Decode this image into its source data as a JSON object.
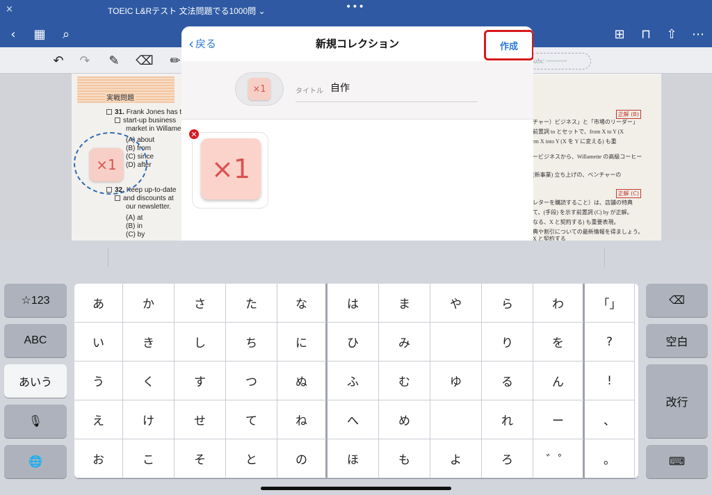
{
  "app": {
    "close_glyph": "×",
    "window_title": "TOEIC L&Rテスト 文法問題でる1000問 ⌄",
    "dots": "•••"
  },
  "nav": {
    "icons": [
      "back-icon",
      "grid-icon",
      "search-icon",
      "add-page-icon",
      "bookmark-icon",
      "share-icon",
      "more-icon"
    ],
    "glyphs": {
      "back": "‹",
      "grid": "▦",
      "search": "⌕",
      "addpage": "⊞",
      "bookmark": "⊓",
      "share": "⇧",
      "more": "⋯"
    }
  },
  "toolbar": {
    "tools": [
      "undo-icon",
      "redo-icon",
      "pen-icon",
      "eraser-icon",
      "highlighter-icon"
    ],
    "glyphs": {
      "undo": "↶",
      "redo": "↷",
      "pen": "✎",
      "eraser": "⌫",
      "highlighter": "✏"
    },
    "abc_placeholder": "abc ~~~~~"
  },
  "document": {
    "section_header": "実戦問題",
    "q31": {
      "number": "31.",
      "lines": [
        "Frank Jones has t",
        "start-up business",
        "market in Willame"
      ],
      "options": [
        "(A) about",
        "(B) from",
        "(C) since",
        "(D) after"
      ]
    },
    "q32": {
      "number": "32.",
      "lines": [
        "Keep up-to-date",
        "and discounts at",
        "our newsletter."
      ],
      "options": [
        "(A) at",
        "(B) in",
        "(C) by"
      ]
    },
    "right_lines": [
      "チャー）ビジネス」と「市場のリーダー」",
      "前置詞 to とセットで、from X to Y (X",
      "rm X into Y (X を Y に変える) も重",
      "",
      "ービジネスから、Willamette の高級コーヒー",
      "",
      "(新事業) 立ち上げの、ベンチャーの",
      "",
      "レターを購読すること）は、店舗の特典",
      "て、(手段) を示す前置詞 (C) by が正解。",
      "なる、X と契約する) も重要表現。",
      "典や割引についての最新情報を得ましょう。",
      "X と契約する"
    ],
    "answer_tags": [
      "正解 (B)",
      "正解 (C)"
    ],
    "sticker_text": "×1"
  },
  "modal": {
    "back_label": "戻る",
    "title": "新規コレクション",
    "create_label": "作成",
    "title_field_label": "タイトル",
    "title_field_value": "自作",
    "thumb_text": "×1",
    "card_text": "×1",
    "delete_glyph": "✕"
  },
  "keyboard": {
    "left_keys": [
      "☆123",
      "ABC",
      "あいう",
      "🎙",
      "🌐"
    ],
    "right_keys": [
      "⌫",
      "空白",
      "改行",
      "⌨"
    ],
    "kana_rows": [
      [
        "あ",
        "か",
        "さ",
        "た",
        "な",
        "は",
        "ま",
        "や",
        "ら",
        "わ",
        "「」"
      ],
      [
        "い",
        "き",
        "し",
        "ち",
        "に",
        "ひ",
        "み",
        "",
        "り",
        "を",
        "?"
      ],
      [
        "う",
        "く",
        "す",
        "つ",
        "ぬ",
        "ふ",
        "む",
        "ゆ",
        "る",
        "ん",
        "!"
      ],
      [
        "え",
        "け",
        "せ",
        "て",
        "ね",
        "へ",
        "め",
        "",
        "れ",
        "ー",
        "、"
      ],
      [
        "お",
        "こ",
        "そ",
        "と",
        "の",
        "ほ",
        "も",
        "よ",
        "ろ",
        "゛゜",
        "。"
      ]
    ]
  },
  "colors": {
    "brand_blue": "#2f5aa3",
    "link_blue": "#2f7ad6",
    "highlight_red": "#d7191c",
    "sticker_pink": "#f8cfc6"
  }
}
